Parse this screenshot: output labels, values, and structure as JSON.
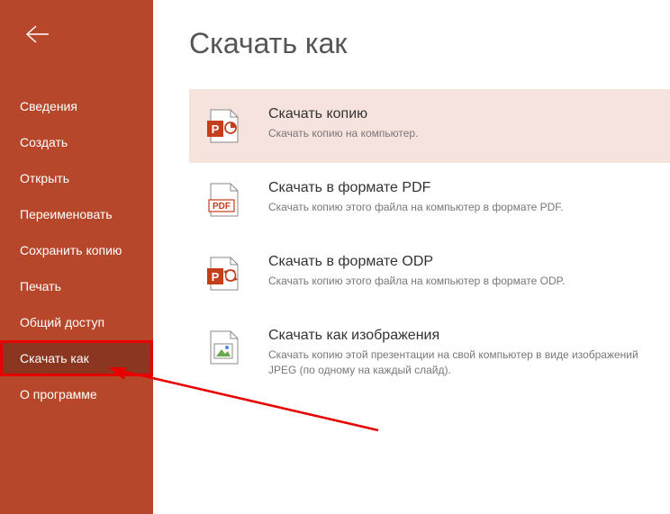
{
  "page_title": "Скачать как",
  "sidebar": {
    "items": [
      {
        "label": "Сведения",
        "active": false
      },
      {
        "label": "Создать",
        "active": false
      },
      {
        "label": "Открыть",
        "active": false
      },
      {
        "label": "Переименовать",
        "active": false
      },
      {
        "label": "Сохранить копию",
        "active": false
      },
      {
        "label": "Печать",
        "active": false
      },
      {
        "label": "Общий доступ",
        "active": false
      },
      {
        "label": "Скачать как",
        "active": true
      },
      {
        "label": "О программе",
        "active": false
      }
    ]
  },
  "options": [
    {
      "icon": "powerpoint-file-icon",
      "title": "Скачать копию",
      "desc": "Скачать копию на компьютер.",
      "selected": true
    },
    {
      "icon": "pdf-file-icon",
      "title": "Скачать в формате PDF",
      "desc": "Скачать копию этого файла на компьютер в формате PDF.",
      "selected": false
    },
    {
      "icon": "odp-file-icon",
      "title": "Скачать в формате ODP",
      "desc": "Скачать копию этого файла на компьютер в формате ODP.",
      "selected": false
    },
    {
      "icon": "image-file-icon",
      "title": "Скачать как изображения",
      "desc": "Скачать копию этой презентации на свой компьютер в виде изображений JPEG (по одному на каждый слайд).",
      "selected": false
    }
  ],
  "icon_labels": {
    "pdf": "PDF"
  }
}
